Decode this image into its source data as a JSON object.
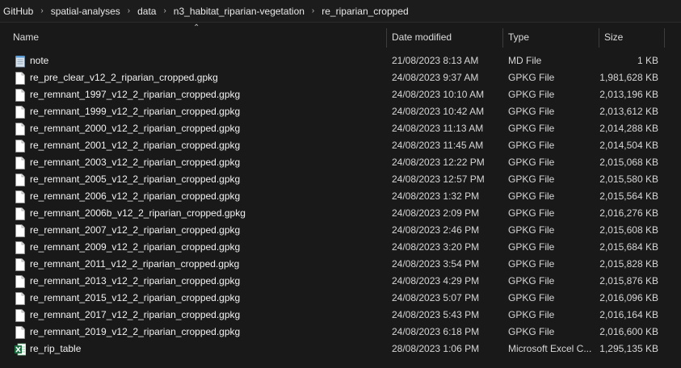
{
  "breadcrumb": [
    "GitHub",
    "spatial-analyses",
    "data",
    "n3_habitat_riparian-vegetation",
    "re_riparian_cropped"
  ],
  "columns": {
    "name": "Name",
    "date": "Date modified",
    "type": "Type",
    "size": "Size"
  },
  "files": [
    {
      "name": "note",
      "date": "21/08/2023 8:13 AM",
      "type": "MD File",
      "size": "1 KB",
      "icon": "notepad-icon"
    },
    {
      "name": "re_pre_clear_v12_2_riparian_cropped.gpkg",
      "date": "24/08/2023 9:37 AM",
      "type": "GPKG File",
      "size": "1,981,628 KB",
      "icon": "file-icon"
    },
    {
      "name": "re_remnant_1997_v12_2_riparian_cropped.gpkg",
      "date": "24/08/2023 10:10 AM",
      "type": "GPKG File",
      "size": "2,013,196 KB",
      "icon": "file-icon"
    },
    {
      "name": "re_remnant_1999_v12_2_riparian_cropped.gpkg",
      "date": "24/08/2023 10:42 AM",
      "type": "GPKG File",
      "size": "2,013,612 KB",
      "icon": "file-icon"
    },
    {
      "name": "re_remnant_2000_v12_2_riparian_cropped.gpkg",
      "date": "24/08/2023 11:13 AM",
      "type": "GPKG File",
      "size": "2,014,288 KB",
      "icon": "file-icon"
    },
    {
      "name": "re_remnant_2001_v12_2_riparian_cropped.gpkg",
      "date": "24/08/2023 11:45 AM",
      "type": "GPKG File",
      "size": "2,014,504 KB",
      "icon": "file-icon"
    },
    {
      "name": "re_remnant_2003_v12_2_riparian_cropped.gpkg",
      "date": "24/08/2023 12:22 PM",
      "type": "GPKG File",
      "size": "2,015,068 KB",
      "icon": "file-icon"
    },
    {
      "name": "re_remnant_2005_v12_2_riparian_cropped.gpkg",
      "date": "24/08/2023 12:57 PM",
      "type": "GPKG File",
      "size": "2,015,580 KB",
      "icon": "file-icon"
    },
    {
      "name": "re_remnant_2006_v12_2_riparian_cropped.gpkg",
      "date": "24/08/2023 1:32 PM",
      "type": "GPKG File",
      "size": "2,015,564 KB",
      "icon": "file-icon"
    },
    {
      "name": "re_remnant_2006b_v12_2_riparian_cropped.gpkg",
      "date": "24/08/2023 2:09 PM",
      "type": "GPKG File",
      "size": "2,016,276 KB",
      "icon": "file-icon"
    },
    {
      "name": "re_remnant_2007_v12_2_riparian_cropped.gpkg",
      "date": "24/08/2023 2:46 PM",
      "type": "GPKG File",
      "size": "2,015,608 KB",
      "icon": "file-icon"
    },
    {
      "name": "re_remnant_2009_v12_2_riparian_cropped.gpkg",
      "date": "24/08/2023 3:20 PM",
      "type": "GPKG File",
      "size": "2,015,684 KB",
      "icon": "file-icon"
    },
    {
      "name": "re_remnant_2011_v12_2_riparian_cropped.gpkg",
      "date": "24/08/2023 3:54 PM",
      "type": "GPKG File",
      "size": "2,015,828 KB",
      "icon": "file-icon"
    },
    {
      "name": "re_remnant_2013_v12_2_riparian_cropped.gpkg",
      "date": "24/08/2023 4:29 PM",
      "type": "GPKG File",
      "size": "2,015,876 KB",
      "icon": "file-icon"
    },
    {
      "name": "re_remnant_2015_v12_2_riparian_cropped.gpkg",
      "date": "24/08/2023 5:07 PM",
      "type": "GPKG File",
      "size": "2,016,096 KB",
      "icon": "file-icon"
    },
    {
      "name": "re_remnant_2017_v12_2_riparian_cropped.gpkg",
      "date": "24/08/2023 5:43 PM",
      "type": "GPKG File",
      "size": "2,016,164 KB",
      "icon": "file-icon"
    },
    {
      "name": "re_remnant_2019_v12_2_riparian_cropped.gpkg",
      "date": "24/08/2023 6:18 PM",
      "type": "GPKG File",
      "size": "2,016,600 KB",
      "icon": "file-icon"
    },
    {
      "name": "re_rip_table",
      "date": "28/08/2023 1:06 PM",
      "type": "Microsoft Excel C...",
      "size": "1,295,135 KB",
      "icon": "excel-icon"
    }
  ],
  "colors": {
    "background": "#191919",
    "text": "#ffffff",
    "excel_green": "#1d6f42"
  }
}
